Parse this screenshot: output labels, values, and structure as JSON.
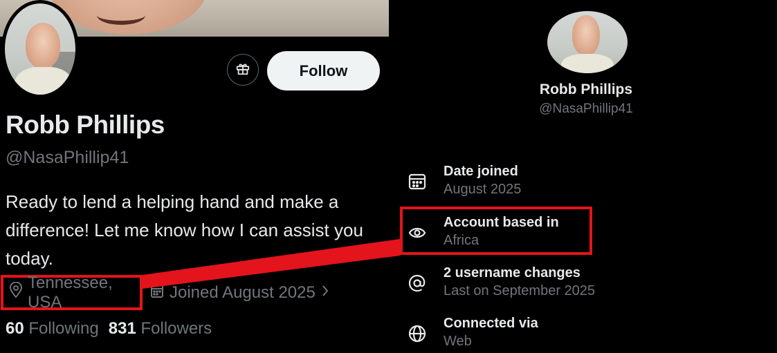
{
  "left_profile": {
    "follow_label": "Follow",
    "name": "Robb Phillips",
    "handle": "@NasaPhillip41",
    "bio": "Ready to lend a helping hand and make a difference! Let me know how I can assist you today.",
    "location": "Tennessee, USA",
    "joined": "Joined August 2025",
    "following_count": "60",
    "following_label": "Following",
    "followers_count": "831",
    "followers_label": "Followers"
  },
  "right_profile": {
    "name": "Robb Phillips",
    "handle": "@NasaPhillip41",
    "items": [
      {
        "icon": "calendar-icon",
        "title": "Date joined",
        "value": "August 2025"
      },
      {
        "icon": "location-pin-icon",
        "title": "Account based in",
        "value": "Africa"
      },
      {
        "icon": "at-sign-icon",
        "title": "2 username changes",
        "value": "Last on September 2025"
      },
      {
        "icon": "globe-icon",
        "title": "Connected via",
        "value": "Web"
      }
    ]
  },
  "colors": {
    "background": "#000000",
    "primary_text": "#e7e9ea",
    "secondary_text": "#71767b",
    "highlight": "#e3141b",
    "button_bg": "#eff3f4"
  }
}
